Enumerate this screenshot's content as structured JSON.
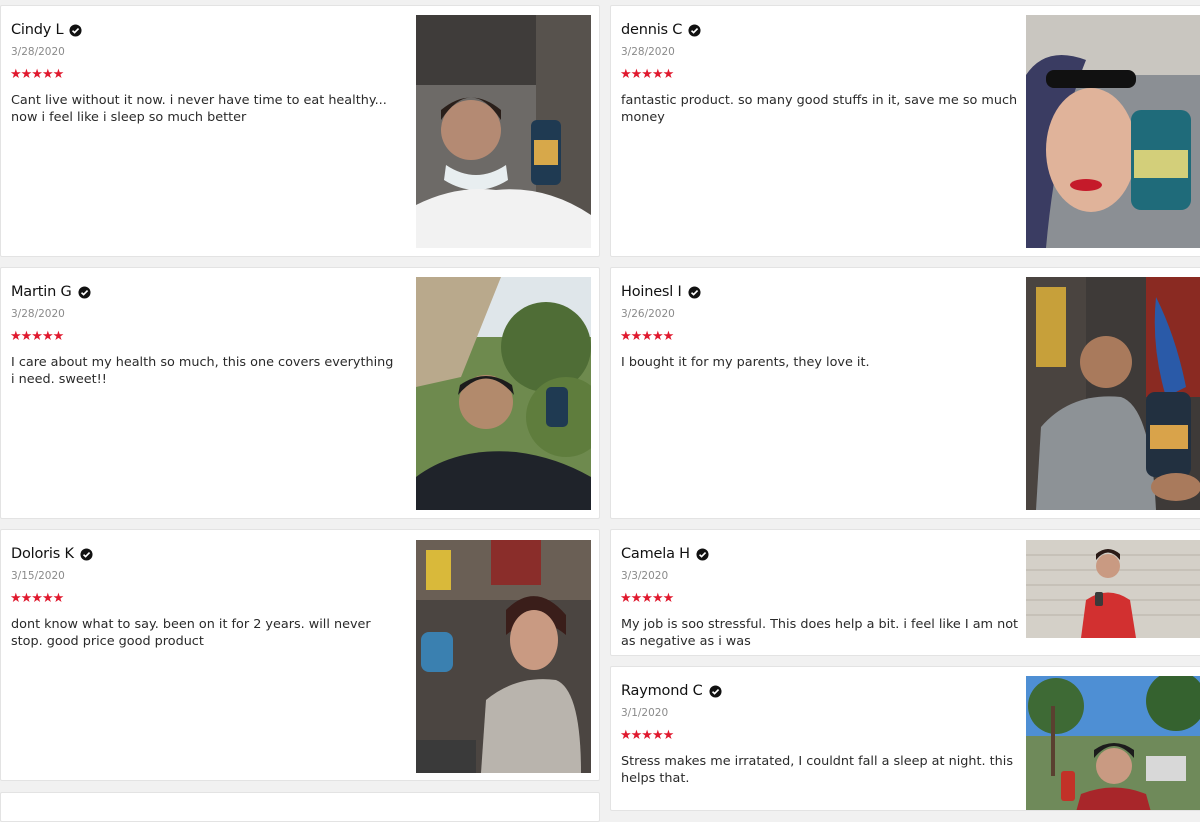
{
  "reviews": [
    {
      "name": "Cindy L",
      "date": "3/28/2020",
      "stars": "★★★★★",
      "text": "Cant live without it now. i never have time to eat healthy... now i feel like i sleep so much better"
    },
    {
      "name": "dennis C",
      "date": "3/28/2020",
      "stars": "★★★★★",
      "text": "fantastic product. so many good stuffs in it, save me so much money"
    },
    {
      "name": "Martin G",
      "date": "3/28/2020",
      "stars": "★★★★★",
      "text": "I care about my health so much, this one covers everything i need. sweet!!"
    },
    {
      "name": "Hoinesl I",
      "date": "3/26/2020",
      "stars": "★★★★★",
      "text": "I bought it for my parents, they love it."
    },
    {
      "name": "Doloris K",
      "date": "3/15/2020",
      "stars": "★★★★★",
      "text": "dont know what to say. been on it for 2 years. will never stop. good price good product"
    },
    {
      "name": "Camela H",
      "date": "3/3/2020",
      "stars": "★★★★★",
      "text": "My job is soo stressful. This does help a bit. i feel like I am not as negative as i was"
    },
    {
      "name": "Raymond C",
      "date": "3/1/2020",
      "stars": "★★★★★",
      "text": "Stress makes me irratated, I couldnt fall a sleep at night. this helps that."
    }
  ],
  "colors": {
    "star": "#e0192e",
    "background": "#f1f1f1",
    "card": "#ffffff"
  },
  "icons": {
    "verified": "verified-check-icon",
    "star": "star-icon"
  }
}
